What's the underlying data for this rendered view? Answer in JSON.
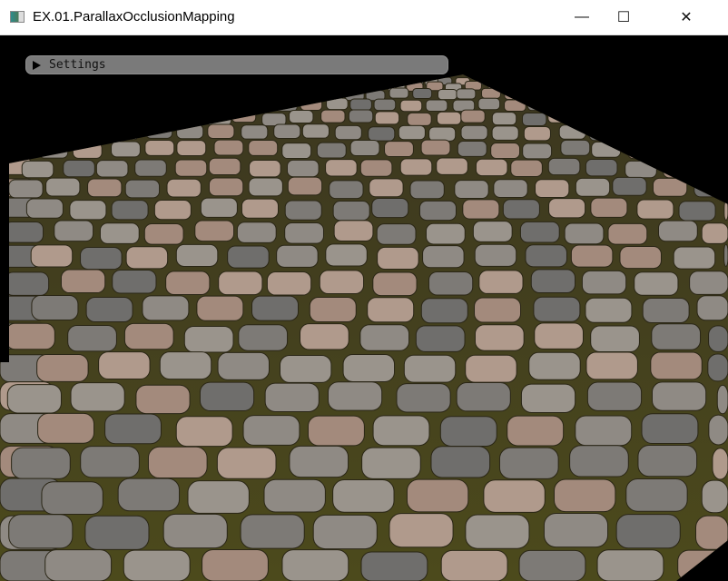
{
  "window": {
    "title": "EX.01.ParallaxOcclusionMapping",
    "minimize": "—",
    "maximize": "☐",
    "close": "✕"
  },
  "settings_panel": {
    "label": "Settings",
    "expanded": false
  },
  "colors": {
    "moss": "#4a4a1e",
    "stone": "#8f8a84",
    "stone_warm": "#a38a7c"
  }
}
